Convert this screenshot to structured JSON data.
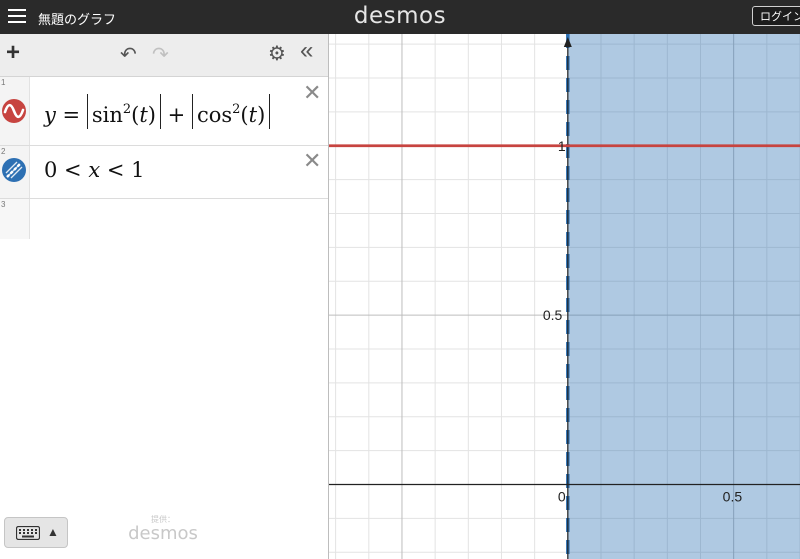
{
  "header": {
    "menu_icon": "hamburger-icon",
    "doc_title": "無題のグラフ",
    "logo": "desmos",
    "login_label": "ログイン"
  },
  "toolbar": {
    "add_icon": "plus-icon",
    "undo_icon": "undo-icon",
    "redo_icon": "redo-icon",
    "settings_icon": "gear-icon",
    "collapse_icon": "double-chevron-left-icon"
  },
  "expressions": [
    {
      "index": "1",
      "icon": "wave-icon",
      "color": "#c74440",
      "latex": "y = |sin²(t)| + |cos²(t)|"
    },
    {
      "index": "2",
      "icon": "shade-icon",
      "color": "#2d70b3",
      "latex": "0 < x < 1"
    },
    {
      "index": "3",
      "icon": "",
      "color": "",
      "latex": ""
    }
  ],
  "footer": {
    "keyboard_icon": "keyboard-icon",
    "powered_by": "提供：",
    "powered_logo": "desmos"
  },
  "graph": {
    "x_range": [
      -0.72,
      0.7
    ],
    "y_range": [
      -0.22,
      1.33
    ],
    "grid_step": 0.1,
    "tick_labels_x": [
      "0",
      "0.5"
    ],
    "tick_labels_y": [
      "0.5",
      "1"
    ],
    "line_y": 1,
    "line_color": "#c74440",
    "shade_x_range": [
      0,
      1
    ],
    "shade_color": "#2d70b3"
  }
}
